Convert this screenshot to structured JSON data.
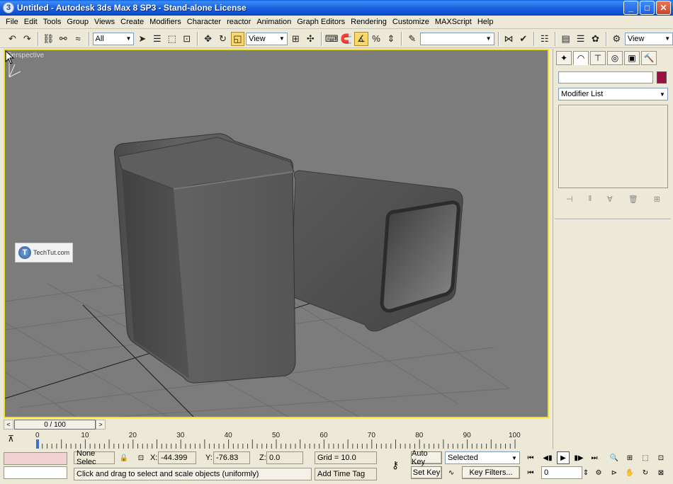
{
  "window": {
    "title": "Untitled - Autodesk 3ds Max 8 SP3  - Stand-alone License",
    "app_icon": "3",
    "minimize": "_",
    "maximize": "□",
    "close": "✕"
  },
  "menu": [
    "File",
    "Edit",
    "Tools",
    "Group",
    "Views",
    "Create",
    "Modifiers",
    "Character",
    "reactor",
    "Animation",
    "Graph Editors",
    "Rendering",
    "Customize",
    "MAXScript",
    "Help"
  ],
  "toolbar": {
    "selection_filter": "All",
    "reference_coord": "View",
    "named_selection": "",
    "render_view": "View"
  },
  "viewport": {
    "label": "Perspective",
    "background_color": "#7c7c7c",
    "border_color": "#f4e22a"
  },
  "watermark": {
    "logo": "T",
    "text": "TechTut.com"
  },
  "command_panel": {
    "object_name": "",
    "object_color": "#9a1040",
    "modifier_list": "Modifier List"
  },
  "time_slider": {
    "position": "0 / 100",
    "prev": "<",
    "next": ">",
    "ticks": [
      "0",
      "10",
      "20",
      "30",
      "40",
      "50",
      "60",
      "70",
      "80",
      "90",
      "100"
    ]
  },
  "status": {
    "selection": "None Selec",
    "x_label": "X:",
    "x_value": "-44.399",
    "y_label": "Y:",
    "y_value": "-76.83",
    "z_label": "Z:",
    "z_value": "0.0",
    "grid": "Grid = 10.0",
    "prompt": "Click and drag to select and scale objects (uniformly)",
    "add_time_tag": "Add Time Tag",
    "auto_key": "Auto Key",
    "set_key": "Set Key",
    "key_mode": "Selected",
    "key_filters": "Key Filters...",
    "current_frame": "0"
  }
}
